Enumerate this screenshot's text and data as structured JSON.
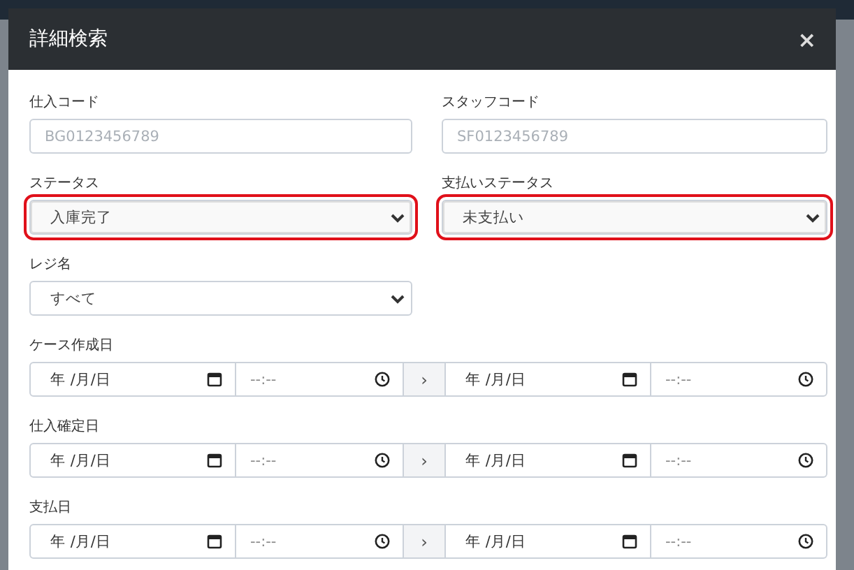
{
  "dialog": {
    "title": "詳細検索",
    "close": "×"
  },
  "text_fields": [
    {
      "label": "仕入コード",
      "placeholder": "BG0123456789"
    },
    {
      "label": "スタッフコード",
      "placeholder": "SF0123456789"
    }
  ],
  "selects": [
    {
      "label": "ステータス",
      "value": "入庫完了",
      "highlighted": true
    },
    {
      "label": "支払いステータス",
      "value": "未支払い",
      "highlighted": true
    },
    {
      "label": "レジ名",
      "value": "すべて",
      "highlighted": false
    }
  ],
  "date_ranges": [
    {
      "label": "ケース作成日",
      "from_date": "年 /月/日",
      "from_time": "--:--",
      "separator": "›",
      "to_date": "年 /月/日",
      "to_time": "--:--"
    },
    {
      "label": "仕入確定日",
      "from_date": "年 /月/日",
      "from_time": "--:--",
      "separator": "›",
      "to_date": "年 /月/日",
      "to_time": "--:--"
    },
    {
      "label": "支払日",
      "from_date": "年 /月/日",
      "from_time": "--:--",
      "separator": "›",
      "to_date": "年 /月/日",
      "to_time": "--:--"
    }
  ]
}
